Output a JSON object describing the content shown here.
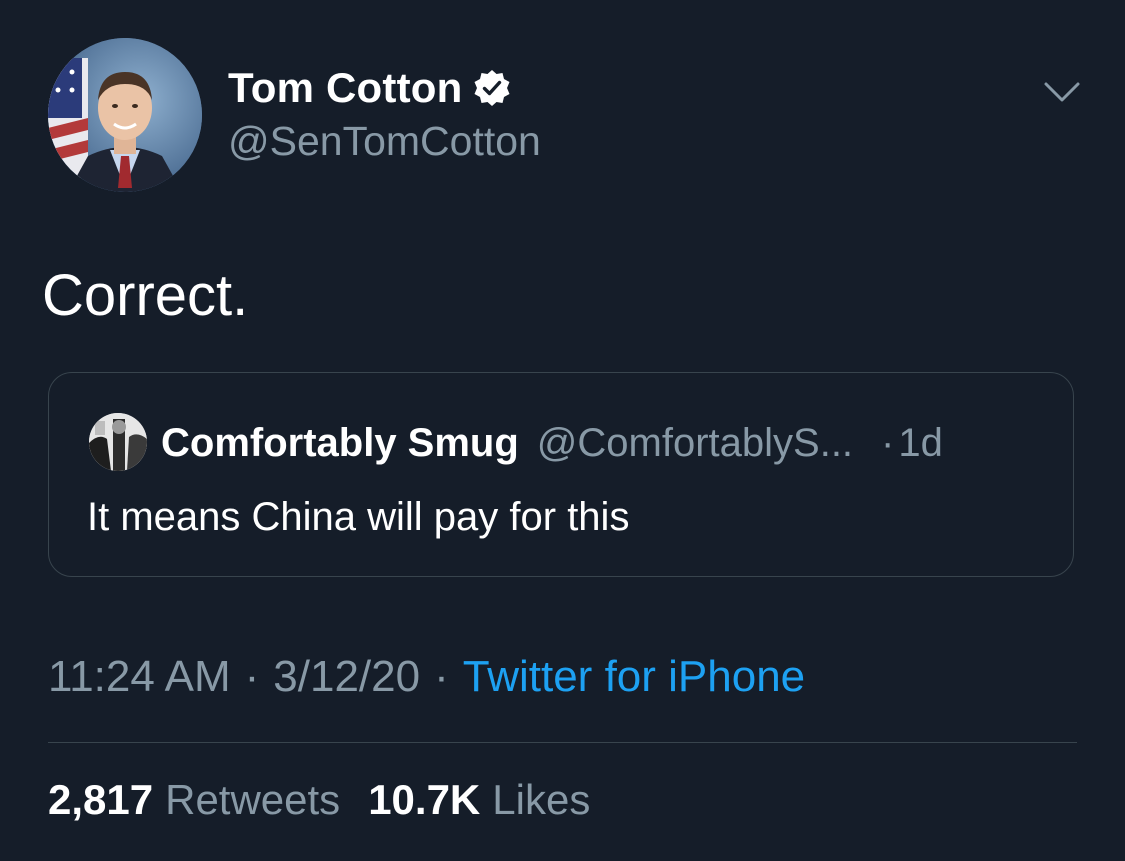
{
  "author": {
    "display_name": "Tom Cotton",
    "handle": "@SenTomCotton",
    "verified": true,
    "avatar_icon": "senator-portrait-avatar"
  },
  "tweet": {
    "text": "Correct."
  },
  "quoted_tweet": {
    "display_name": "Comfortably Smug",
    "handle": "@ComfortablyS...",
    "separator": "·",
    "time": "1d",
    "text": "It means China will pay for this",
    "avatar_icon": "bw-photo-avatar"
  },
  "meta": {
    "time": "11:24 AM",
    "separator": "·",
    "date": "3/12/20",
    "source": "Twitter for iPhone"
  },
  "stats": {
    "retweets_count": "2,817",
    "retweets_label": "Retweets",
    "likes_count": "10.7K",
    "likes_label": "Likes"
  },
  "colors": {
    "background": "#151d29",
    "text_primary": "#ffffff",
    "text_secondary": "#8899a6",
    "link": "#1da1f2",
    "border": "#38444d"
  }
}
